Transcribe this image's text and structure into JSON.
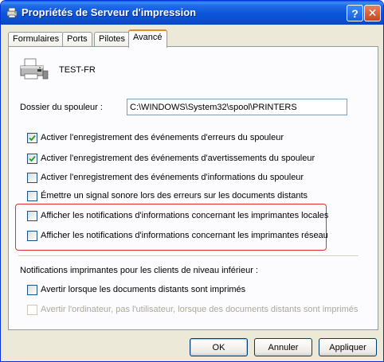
{
  "window": {
    "title": "Propriétés de Serveur d'impression",
    "help_symbol": "?",
    "close_symbol": "✕"
  },
  "tabs": [
    {
      "label": "Formulaires",
      "active": false
    },
    {
      "label": "Ports",
      "active": false
    },
    {
      "label": "Pilotes",
      "active": false
    },
    {
      "label": "Avancé",
      "active": true
    }
  ],
  "server": {
    "name": "TEST-FR"
  },
  "spool": {
    "label": "Dossier du spouleur :",
    "value": "C:\\WINDOWS\\System32\\spool\\PRINTERS"
  },
  "options": [
    {
      "label": "Activer l'enregistrement des événements d'erreurs du spouleur",
      "checked": true
    },
    {
      "label": "Activer l'enregistrement des événements d'avertissements du spouleur",
      "checked": true
    },
    {
      "label": "Activer l'enregistrement des événements d'informations du spouleur",
      "checked": false
    },
    {
      "label": "Émettre un signal sonore lors des erreurs sur les documents distants",
      "checked": false
    },
    {
      "label": "Afficher les notifications d'informations concernant les imprimantes locales",
      "checked": false
    },
    {
      "label": "Afficher les notifications d'informations concernant les imprimantes réseau",
      "checked": false
    }
  ],
  "downlevel": {
    "label": "Notifications imprimantes pour les clients de niveau inférieur :",
    "options": [
      {
        "label": "Avertir lorsque les documents distants sont imprimés",
        "checked": false,
        "enabled": true
      },
      {
        "label": "Avertir l'ordinateur, pas l'utilisateur, lorsque des documents distants sont imprimés",
        "checked": false,
        "enabled": false
      }
    ]
  },
  "buttons": {
    "ok": "OK",
    "cancel": "Annuler",
    "apply": "Appliquer"
  },
  "colors": {
    "highlight_border": "#e03030",
    "titlebar": "#0c55d9",
    "checkmark": "#21a121"
  }
}
